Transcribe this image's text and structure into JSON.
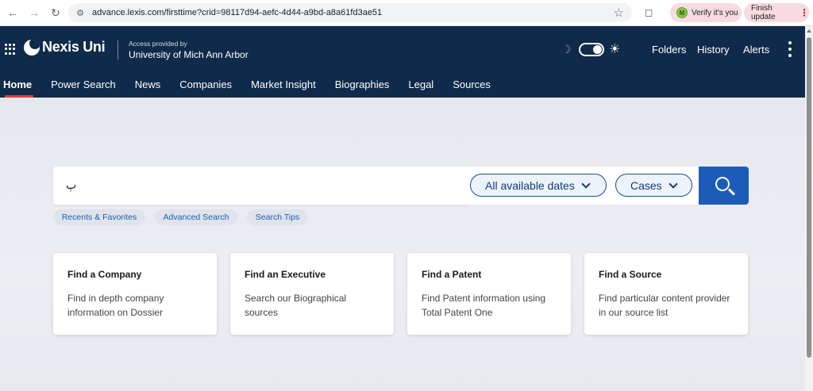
{
  "browser": {
    "url": "advance.lexis.com/firsttime?crid=98117d94-aefc-4d44-a9bd-a8a61fd3ae51",
    "verify_label": "Verify it's you",
    "profile_initial": "M",
    "update_label": "Finish update"
  },
  "header": {
    "brand": "Nexis Uni",
    "access_caption": "Access provided by",
    "institution": "University of Mich Ann Arbor",
    "links": [
      "Folders",
      "History",
      "Alerts"
    ]
  },
  "tabs": [
    "Home",
    "Power Search",
    "News",
    "Companies",
    "Market Insight",
    "Biographies",
    "Legal",
    "Sources"
  ],
  "active_tab": "Home",
  "search": {
    "value": "پ",
    "date_filter": "All available dates",
    "content_filter": "Cases"
  },
  "quick_links": [
    "Recents & Favorites",
    "Advanced Search",
    "Search Tips"
  ],
  "cards": [
    {
      "title": "Find a Company",
      "desc": "Find in depth company information on Dossier"
    },
    {
      "title": "Find an Executive",
      "desc": "Search our Biographical sources"
    },
    {
      "title": "Find a Patent",
      "desc": "Find Patent information using Total Patent One"
    },
    {
      "title": "Find a Source",
      "desc": "Find particular content provider in our source list"
    }
  ],
  "colors": {
    "header_bg": "#0f2a4a",
    "accent_blue": "#1c5bb8",
    "active_tab_underline": "#e23d3d"
  }
}
